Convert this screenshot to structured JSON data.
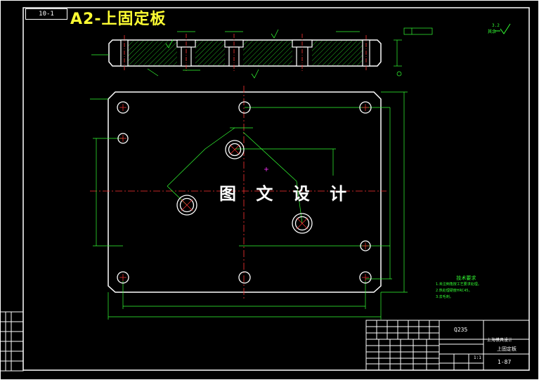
{
  "drawing": {
    "code": "10-1",
    "title": "A2-上固定板",
    "watermark": "图 文 设 计",
    "colors": {
      "background": "#000000",
      "outline": "#ffffff",
      "dimension": "#33ff33",
      "centerline": "#ff3333",
      "title": "#ffff33",
      "hatch": "#33ff33"
    }
  },
  "tech_notes": {
    "heading": "技术要求",
    "lines": [
      "1.未注倒角按工艺要求处理。",
      "2.热处理硬度HRC45。",
      "3.去毛刺。"
    ]
  },
  "title_block": {
    "material": "Q235",
    "design_unit": "上海模具设计",
    "part_name": "上固定板",
    "scale": "1:1",
    "sheet": "1-87"
  },
  "roughness": {
    "symbol": "3.2",
    "label": "其余"
  }
}
